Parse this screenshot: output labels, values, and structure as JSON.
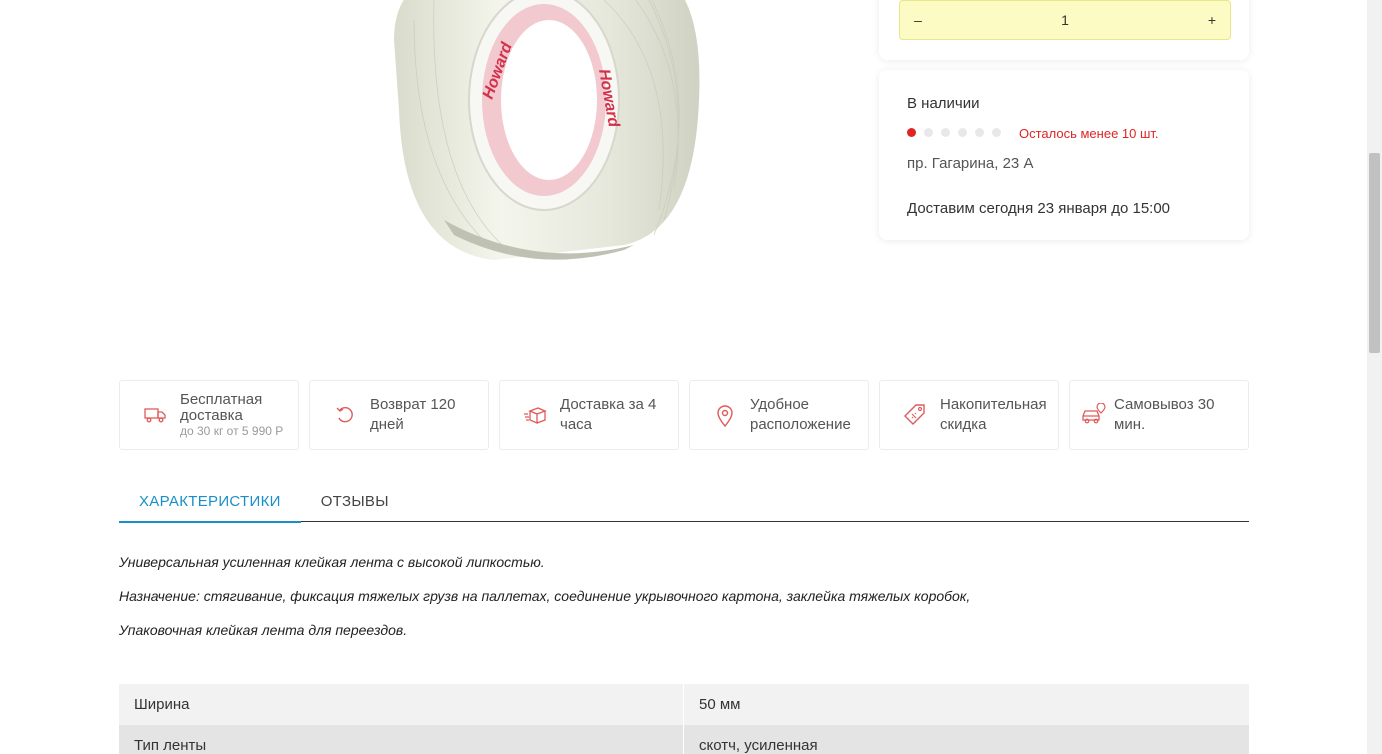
{
  "product": {
    "image_alt": "Howard reinforced tape roll",
    "brand_print": "Howard"
  },
  "quantity": {
    "minus_label": "–",
    "value": "1",
    "plus_label": "+"
  },
  "stock": {
    "title": "В наличии",
    "level_dots_total": 6,
    "level_dots_filled": 1,
    "warning": "Осталось менее 10 шт.",
    "address": "пр. Гагарина, 23 А",
    "delivery": "Доставим сегодня 23 января до 15:00",
    "accent_color": "#e02424"
  },
  "benefits": [
    {
      "icon": "truck-icon",
      "label": "Бесплатная доставка",
      "sub": "до 30 кг от 5 990 Р"
    },
    {
      "icon": "return-arrow-icon",
      "label": "Возврат 120 дней"
    },
    {
      "icon": "box-delivery-icon",
      "label": "Доставка за 4 часа"
    },
    {
      "icon": "location-pin-icon",
      "label": "Удобное расположение"
    },
    {
      "icon": "discount-tag-icon",
      "label": "Накопительная скидка"
    },
    {
      "icon": "car-pickup-icon",
      "label": "Самовывоз 30 мин."
    }
  ],
  "tabs": [
    {
      "label": "ХАРАКТЕРИСТИКИ",
      "active": true
    },
    {
      "label": "ОТЗЫВЫ",
      "active": false
    }
  ],
  "description": [
    "Универсальная усиленная клейкая лента с высокой липкостью.",
    "Назначение: стягивание, фиксация тяжелых грузв на паллетах, соединение укрывочного картона, заклейка тяжелых коробок,",
    "Упаковочная клейкая лента для переездов."
  ],
  "specs": [
    {
      "name": "Ширина",
      "value": "50 мм"
    },
    {
      "name": "Тип ленты",
      "value": "скотч, усиленная"
    }
  ],
  "colors": {
    "tab_active": "#1a8fc7",
    "stepper_bg": "#fdfbc4"
  }
}
